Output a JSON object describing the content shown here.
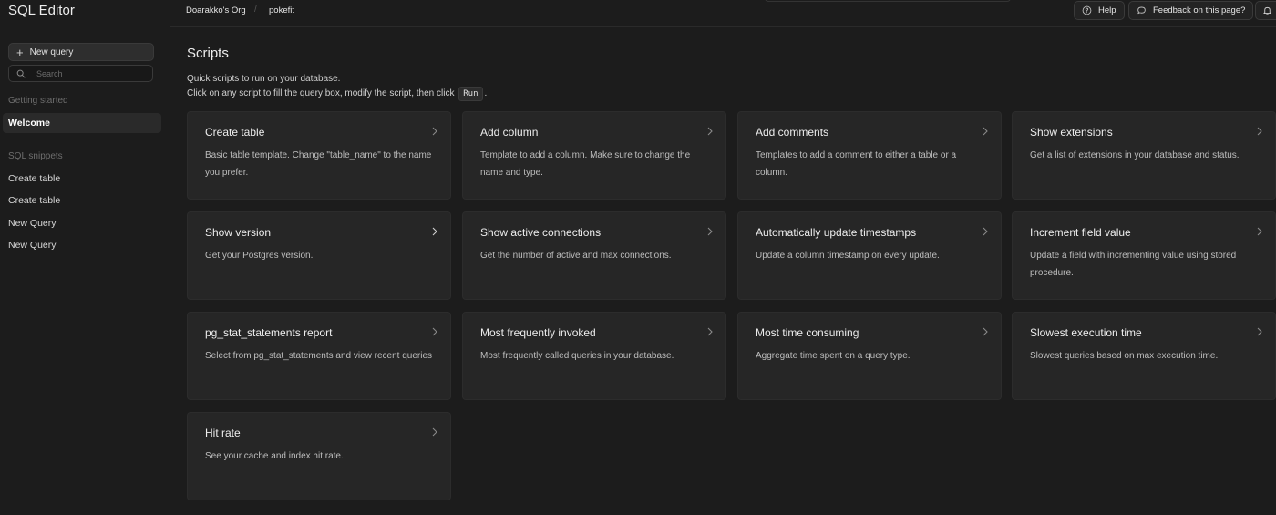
{
  "sidebar": {
    "title": "SQL Editor",
    "new_query_label": "New query",
    "search_placeholder": "Search",
    "getting_started_label": "Getting started",
    "welcome_label": "Welcome",
    "snippets_label": "SQL snippets",
    "snippets": [
      "Create table",
      "Create table",
      "New Query",
      "New Query"
    ]
  },
  "topbar": {
    "org": "Doarakko's Org",
    "separator": "/",
    "project": "pokefit",
    "help_label": "Help",
    "feedback_label": "Feedback on this page?"
  },
  "main": {
    "title": "Scripts",
    "desc_line1": "Quick scripts to run on your database.",
    "desc_line2_pre": "Click on any script to fill the query box, modify the script, then click",
    "run_label": "Run",
    "desc_line2_post": ".",
    "cards": [
      {
        "title": "Create table",
        "desc": "Basic table template. Change \"table_name\" to the name you prefer."
      },
      {
        "title": "Add column",
        "desc": "Template to add a column. Make sure to change the name and type."
      },
      {
        "title": "Add comments",
        "desc": "Templates to add a comment to either a table or a column."
      },
      {
        "title": "Show extensions",
        "desc": "Get a list of extensions in your database and status."
      },
      {
        "title": "Show version",
        "desc": "Get your Postgres version."
      },
      {
        "title": "Show active connections",
        "desc": "Get the number of active and max connections."
      },
      {
        "title": "Automatically update timestamps",
        "desc": "Update a column timestamp on every update."
      },
      {
        "title": "Increment field value",
        "desc": "Update a field with incrementing value using stored procedure."
      },
      {
        "title": "pg_stat_statements report",
        "desc": "Select from pg_stat_statements and view recent queries"
      },
      {
        "title": "Most frequently invoked",
        "desc": "Most frequently called queries in your database."
      },
      {
        "title": "Most time consuming",
        "desc": "Aggregate time spent on a query type."
      },
      {
        "title": "Slowest execution time",
        "desc": "Slowest queries based on max execution time."
      },
      {
        "title": "Hit rate",
        "desc": "See your cache and index hit rate."
      }
    ]
  }
}
